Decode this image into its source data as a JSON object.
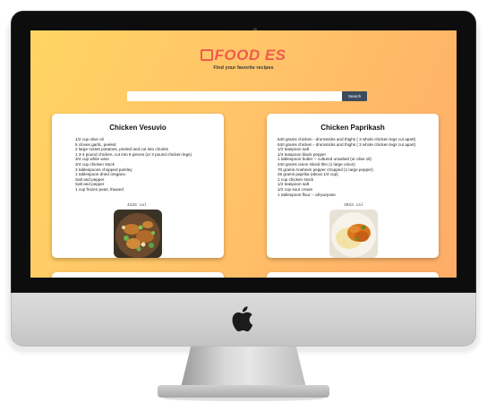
{
  "app": {
    "logo_text": "FOOD ES",
    "tagline": "Find your favorite recipes"
  },
  "search": {
    "placeholder": "",
    "value": "",
    "button_label": "Search"
  },
  "recipes": [
    {
      "title": "Chicken Vesuvio",
      "ingredients": [
        "1/2 cup olive oil",
        "5 cloves garlic, peeled",
        "2 large russet potatoes, peeled and cut into chunks",
        "1 3-4 pound chicken, cut into 8 pieces (or 3 pound chicken legs)",
        "3/4 cup white wine",
        "3/4 cup chicken stock",
        "3 tablespoons chopped parsley",
        "1 tablespoon dried oregano",
        "Salt and pepper",
        "Salt and pepper",
        "1 cup frozen peas, thawed"
      ],
      "calories": "4228 cal"
    },
    {
      "title": "Chicken Paprikash",
      "ingredients": [
        "640 grams chicken - drumsticks and thighs ( 3 whole chicken legs cut apart)",
        "640 grams chicken - drumsticks and thighs ( 3 whole chicken legs cut apart)",
        "1/2 teaspoon salt",
        "1/4 teaspoon black pepper",
        "1 tablespoon butter -- cultured unsalted (or olive oil)",
        "240 grams onion sliced thin (1 large onion)",
        "70 grams Anaheim pepper chopped (1 large pepper)",
        "25 grams paprika (about 1/4 cup)",
        "1 cup chicken stock",
        "1/2 teaspoon salt",
        "1/2 cup sour cream",
        "1 tablespoon flour -- all-purpose"
      ],
      "calories": "3033 cal"
    }
  ],
  "colors": {
    "gradient_start": "#ffd463",
    "gradient_end": "#ffac68",
    "logo": "#f05a4f",
    "button": "#3d4a5c"
  },
  "icons": {
    "device_logo": "apple-icon"
  }
}
